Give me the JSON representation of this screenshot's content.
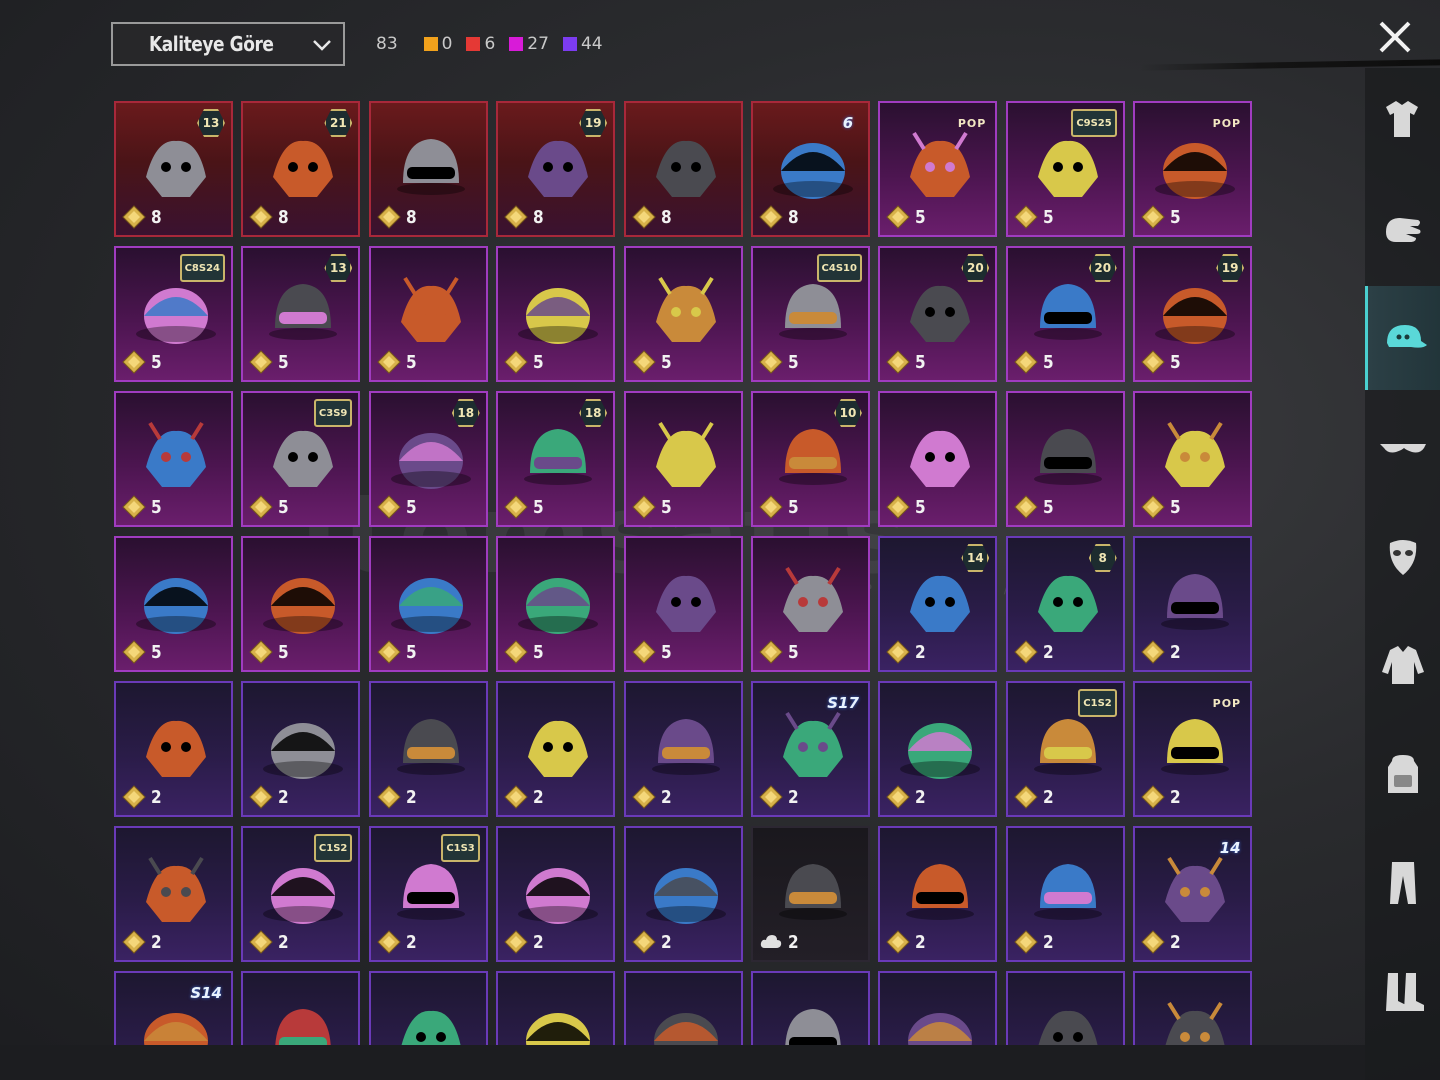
{
  "sort": {
    "label": "Kaliteye Göre"
  },
  "counts": {
    "total": "83",
    "items": [
      {
        "color": "#f2a21c",
        "value": "0"
      },
      {
        "color": "#e53935",
        "value": "6"
      },
      {
        "color": "#d81bd8",
        "value": "27"
      },
      {
        "color": "#7c3cf0",
        "value": "44"
      }
    ]
  },
  "watermark": {
    "main": "itemsatis",
    "sub": "HESAP / SKIN / ITEM / E...N .com"
  },
  "cards": [
    {
      "q": "red",
      "badge": "13",
      "value": "8",
      "icon": "flower-hat-icon",
      "t": "hex"
    },
    {
      "q": "red",
      "badge": "21",
      "value": "8",
      "icon": "clown-mask-icon",
      "t": "hex"
    },
    {
      "q": "red",
      "badge": "",
      "value": "8",
      "icon": "demon-helmet-icon",
      "t": ""
    },
    {
      "q": "red",
      "badge": "19",
      "value": "8",
      "icon": "carbon-helmet-icon",
      "t": "hex"
    },
    {
      "q": "red",
      "badge": "",
      "value": "8",
      "icon": "red-helmet-icon",
      "t": ""
    },
    {
      "q": "red",
      "badge": "6",
      "value": "8",
      "icon": "tv-head-icon",
      "t": "season"
    },
    {
      "q": "pink",
      "badge": "POP",
      "value": "5",
      "icon": "bow-headband-icon",
      "t": "pop"
    },
    {
      "q": "pink",
      "badge": "C9S25",
      "value": "5",
      "icon": "silver-hair-icon",
      "t": "wide"
    },
    {
      "q": "pink",
      "badge": "POP",
      "value": "5",
      "icon": "cube-head-icon",
      "t": "pop"
    },
    {
      "q": "pink",
      "badge": "C8S24",
      "value": "5",
      "icon": "black-hair-icon",
      "t": "wide"
    },
    {
      "q": "pink",
      "badge": "13",
      "value": "5",
      "icon": "goggles-cap-icon",
      "t": "hex"
    },
    {
      "q": "pink",
      "badge": "",
      "value": "5",
      "icon": "potato-head-icon",
      "t": ""
    },
    {
      "q": "pink",
      "badge": "",
      "value": "5",
      "icon": "horned-skull-icon",
      "t": ""
    },
    {
      "q": "pink",
      "badge": "",
      "value": "5",
      "icon": "golden-helm-icon",
      "t": ""
    },
    {
      "q": "pink",
      "badge": "C4S10",
      "value": "5",
      "icon": "green-helmet-icon",
      "t": "wide"
    },
    {
      "q": "pink",
      "badge": "20",
      "value": "5",
      "icon": "bunny-hair-icon",
      "t": "hex"
    },
    {
      "q": "pink",
      "badge": "20",
      "value": "5",
      "icon": "gold-mask-icon",
      "t": "hex"
    },
    {
      "q": "pink",
      "badge": "19",
      "value": "5",
      "icon": "bun-hair-icon",
      "t": "hex"
    },
    {
      "q": "pink",
      "badge": "",
      "value": "5",
      "icon": "blue-wolf-icon",
      "t": ""
    },
    {
      "q": "pink",
      "badge": "C3S9",
      "value": "5",
      "icon": "purple-beanie-icon",
      "t": "wide"
    },
    {
      "q": "pink",
      "badge": "18",
      "value": "5",
      "icon": "top-hat-icon",
      "t": "hex"
    },
    {
      "q": "pink",
      "badge": "18",
      "value": "5",
      "icon": "cat-hood-icon",
      "t": "hex"
    },
    {
      "q": "pink",
      "badge": "",
      "value": "5",
      "icon": "nest-hat-icon",
      "t": ""
    },
    {
      "q": "pink",
      "badge": "10",
      "value": "5",
      "icon": "pink-helmet-icon",
      "t": "hex"
    },
    {
      "q": "pink",
      "badge": "",
      "value": "5",
      "icon": "white-hair-icon",
      "t": ""
    },
    {
      "q": "pink",
      "badge": "",
      "value": "5",
      "icon": "feather-crest-icon",
      "t": ""
    },
    {
      "q": "pink",
      "badge": "",
      "value": "5",
      "icon": "orange-bandana-icon",
      "t": ""
    },
    {
      "q": "pink",
      "badge": "",
      "value": "5",
      "icon": "wolf-mask-icon",
      "t": ""
    },
    {
      "q": "pink",
      "badge": "",
      "value": "5",
      "icon": "tribal-helmet-icon",
      "t": ""
    },
    {
      "q": "pink",
      "badge": "",
      "value": "5",
      "icon": "skull-dreads-icon",
      "t": ""
    },
    {
      "q": "pink",
      "badge": "",
      "value": "5",
      "icon": "frog-cap-icon",
      "t": ""
    },
    {
      "q": "pink",
      "badge": "",
      "value": "5",
      "icon": "galaxy-cap-icon",
      "t": ""
    },
    {
      "q": "pink",
      "badge": "",
      "value": "5",
      "icon": "army-helmet-icon",
      "t": ""
    },
    {
      "q": "purple",
      "badge": "14",
      "value": "2",
      "icon": "long-hair-icon",
      "t": "hex"
    },
    {
      "q": "purple",
      "badge": "8",
      "value": "2",
      "icon": "green-skull-icon",
      "t": "hex"
    },
    {
      "q": "purple",
      "badge": "",
      "value": "2",
      "icon": "purple-hood-icon",
      "t": ""
    },
    {
      "q": "purple",
      "badge": "",
      "value": "2",
      "icon": "red-cap-icon",
      "t": ""
    },
    {
      "q": "purple",
      "badge": "",
      "value": "2",
      "icon": "orange-cap-icon",
      "t": ""
    },
    {
      "q": "purple",
      "badge": "",
      "value": "2",
      "icon": "navy-beanie-icon",
      "t": ""
    },
    {
      "q": "purple",
      "badge": "",
      "value": "2",
      "icon": "black-cap-icon",
      "t": ""
    },
    {
      "q": "purple",
      "badge": "",
      "value": "2",
      "icon": "gold-cap-icon",
      "t": ""
    },
    {
      "q": "purple",
      "badge": "S17",
      "value": "2",
      "icon": "horned-helm-icon",
      "t": "season"
    },
    {
      "q": "purple",
      "badge": "",
      "value": "2",
      "icon": "fez-icon",
      "t": ""
    },
    {
      "q": "purple",
      "badge": "C1S2",
      "value": "2",
      "icon": "striped-beanie-icon",
      "t": "wide"
    },
    {
      "q": "purple",
      "badge": "POP",
      "value": "2",
      "icon": "grey-hair-icon",
      "t": "pop"
    },
    {
      "q": "purple",
      "badge": "",
      "value": "2",
      "icon": "tactical-cap-icon",
      "t": ""
    },
    {
      "q": "purple",
      "badge": "C1S2",
      "value": "2",
      "icon": "chef-hat-icon",
      "t": "wide"
    },
    {
      "q": "purple",
      "badge": "C1S3",
      "value": "2",
      "icon": "barrel-hat-icon",
      "t": "wide"
    },
    {
      "q": "purple",
      "badge": "",
      "value": "2",
      "icon": "red-helmet-2-icon",
      "t": ""
    },
    {
      "q": "purple",
      "badge": "",
      "value": "2",
      "icon": "cyber-dreads-icon",
      "t": ""
    },
    {
      "q": "blank",
      "badge": "",
      "value": "2",
      "icon": "brown-beanie-icon",
      "t": "",
      "coin": "cloud"
    },
    {
      "q": "purple",
      "badge": "",
      "value": "2",
      "icon": "mushroom-hat-icon",
      "t": ""
    },
    {
      "q": "purple",
      "badge": "",
      "value": "2",
      "icon": "moto-helmet-icon",
      "t": ""
    },
    {
      "q": "purple",
      "badge": "14",
      "value": "2",
      "icon": "officer-cap-icon",
      "t": "season"
    },
    {
      "q": "purple",
      "badge": "S14",
      "value": "",
      "icon": "knight-helm-icon",
      "t": "season"
    },
    {
      "q": "purple",
      "badge": "",
      "value": "",
      "icon": "pink-moto-icon",
      "t": ""
    },
    {
      "q": "purple",
      "badge": "",
      "value": "",
      "icon": "blue-beanie-icon",
      "t": ""
    },
    {
      "q": "purple",
      "badge": "",
      "value": "",
      "icon": "cat-ears-icon",
      "t": ""
    },
    {
      "q": "purple",
      "badge": "",
      "value": "",
      "icon": "grey-helmet-icon",
      "t": ""
    },
    {
      "q": "purple",
      "badge": "",
      "value": "",
      "icon": "cowboy-hat-icon",
      "t": ""
    },
    {
      "q": "purple",
      "badge": "",
      "value": "",
      "icon": "luchador-mask-icon",
      "t": ""
    },
    {
      "q": "purple",
      "badge": "",
      "value": "",
      "icon": "shark-hat-icon",
      "t": ""
    },
    {
      "q": "purple",
      "badge": "",
      "value": "",
      "icon": "fedora-icon",
      "t": ""
    }
  ],
  "sidebar": [
    {
      "icon": "outfit-icon",
      "active": false
    },
    {
      "icon": "glove-icon",
      "active": false
    },
    {
      "icon": "cap-icon",
      "active": true
    },
    {
      "icon": "glasses-icon",
      "active": false
    },
    {
      "icon": "mask-icon",
      "active": false
    },
    {
      "icon": "jacket-icon",
      "active": false
    },
    {
      "icon": "backpack-icon",
      "active": false
    },
    {
      "icon": "pants-icon",
      "active": false
    },
    {
      "icon": "boots-icon",
      "active": false
    }
  ]
}
